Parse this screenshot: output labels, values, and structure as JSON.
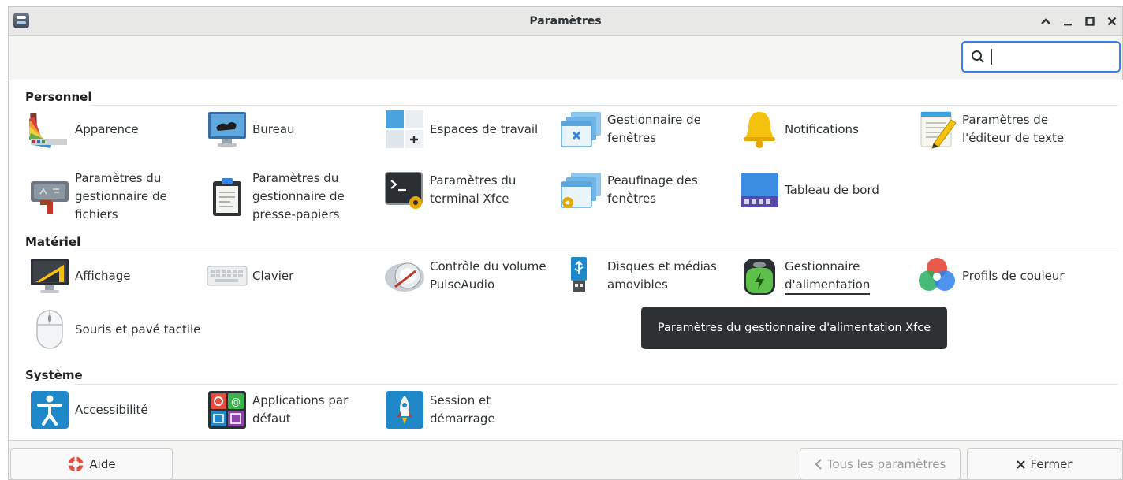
{
  "window": {
    "title": "Paramètres",
    "controls": {
      "up": "^",
      "minimize": "_",
      "maximize": "□",
      "close": "✕"
    }
  },
  "search": {
    "placeholder": "",
    "value": ""
  },
  "sections": {
    "personnel": "Personnel",
    "materiel": "Matériel",
    "systeme": "Système"
  },
  "items": {
    "apparence": "Apparence",
    "bureau": "Bureau",
    "espaces": "Espaces de travail",
    "gest_fenetres": "Gestionnaire de fenêtres",
    "notifications": "Notifications",
    "editeur": "Paramètres de l'éditeur de texte",
    "gest_fichiers": "Paramètres du gestionnaire de fichiers",
    "presse_papiers": "Paramètres du gestionnaire de presse-papiers",
    "terminal": "Paramètres du terminal Xfce",
    "peaufinage": "Peaufinage des fenêtres",
    "tableau": "Tableau de bord",
    "affichage": "Affichage",
    "clavier": "Clavier",
    "volume": "Contrôle du volume PulseAudio",
    "disques": "Disques et médias amovibles",
    "alimentation": "Gestionnaire d'alimentation",
    "couleur": "Profils de couleur",
    "souris": "Souris et pavé tactile",
    "accessibilite": "Accessibilité",
    "applications": "Applications par défaut",
    "session": "Session et démarrage"
  },
  "tooltip": "Paramètres du gestionnaire d'alimentation Xfce",
  "footer": {
    "help": "Aide",
    "all_settings": "Tous les paramètres",
    "close": "Fermer"
  }
}
